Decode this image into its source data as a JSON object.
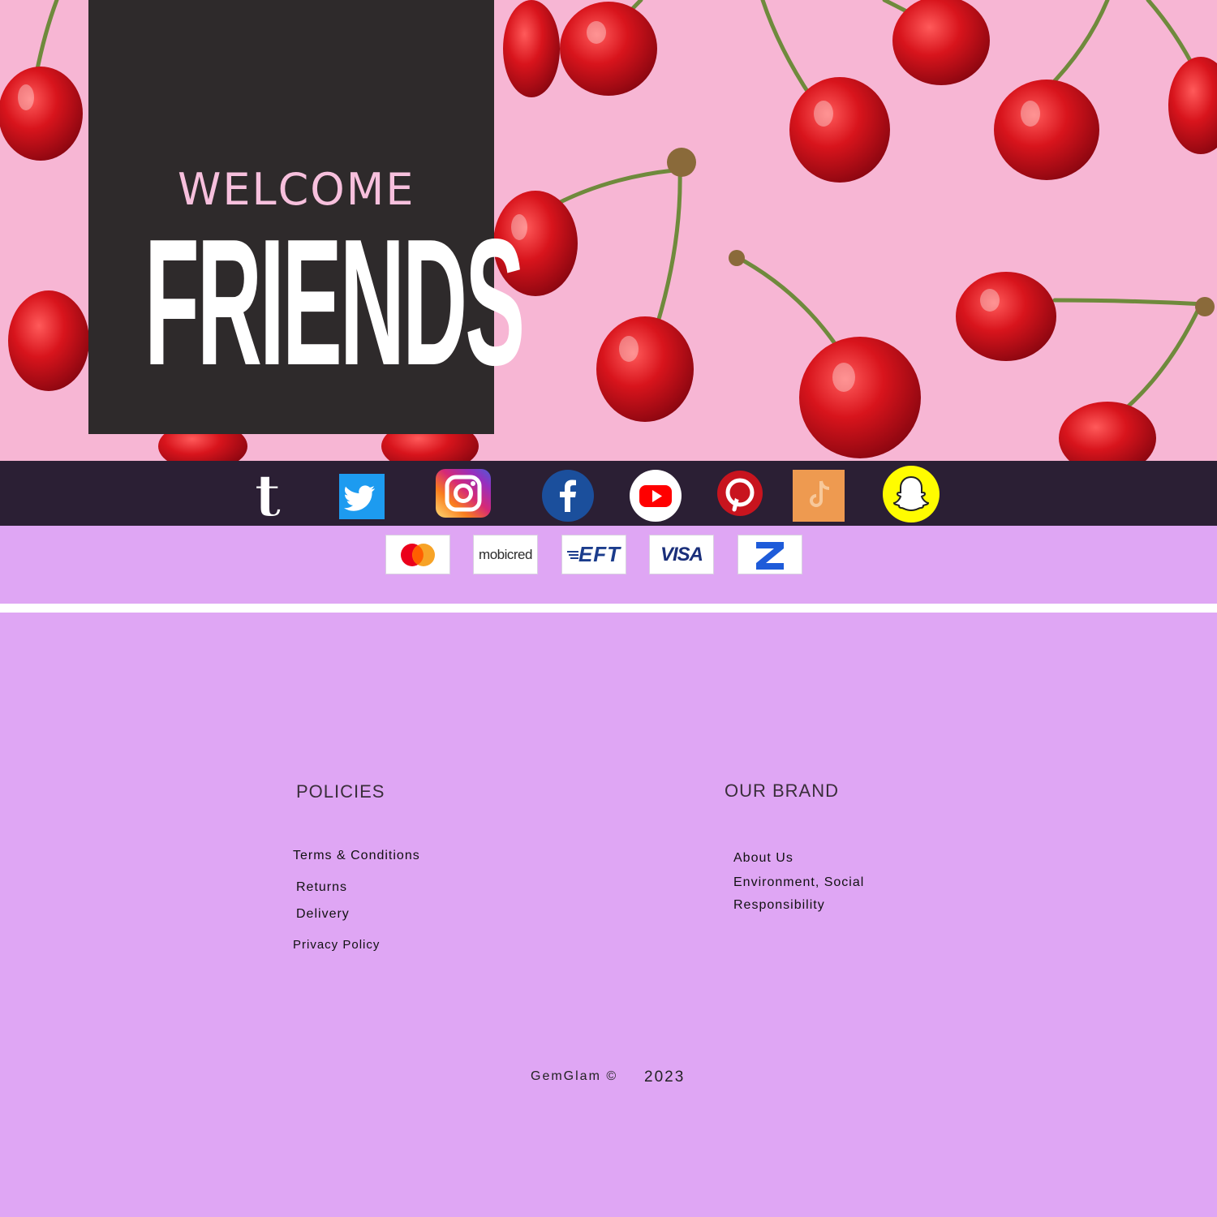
{
  "hero": {
    "welcome": "WELCOME",
    "friends": "FRIENDS"
  },
  "social": {
    "icons": [
      "tumblr-icon",
      "twitter-icon",
      "instagram-icon",
      "facebook-icon",
      "youtube-icon",
      "pinterest-icon",
      "tiktok-icon",
      "snapchat-icon"
    ]
  },
  "payment": {
    "methods": [
      "mastercard-icon",
      "mobicred-logo",
      "eft-logo",
      "visa-logo",
      "zapper-logo"
    ],
    "mobicred": "mobicred",
    "eft": "EFT",
    "visa": "VISA"
  },
  "footer": {
    "policies_heading": "POLICIES",
    "brand_heading": "OUR BRAND",
    "policies": [
      "Terms & Conditions",
      "Returns",
      "Delivery",
      "Privacy Policy"
    ],
    "brand_links": [
      "About Us",
      "Environment, Social",
      "Responsibility"
    ],
    "copyright": "GemGlam ©",
    "year": "2023"
  },
  "colors": {
    "hero_bg": "#f7b6d4",
    "card_bg": "#2e2a2b",
    "social_bar": "#2b1f34",
    "page_bg": "#dfa6f4"
  }
}
